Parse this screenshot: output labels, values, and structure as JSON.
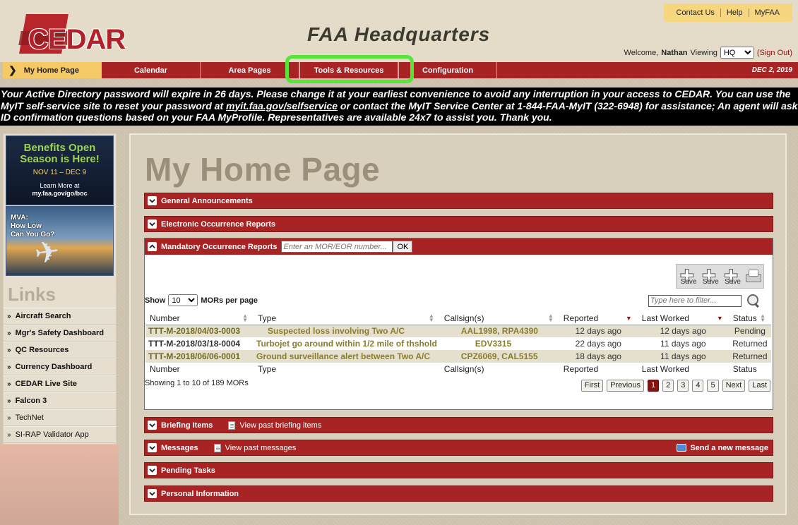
{
  "header": {
    "logo_text": "CEDAR",
    "title": "FAA Headquarters",
    "top_links": [
      "Contact Us",
      "Help",
      "MyFAA"
    ],
    "welcome_label": "Welcome,",
    "user_name": "Nathan",
    "viewing_label": "Viewing",
    "viewing_value": "HQ",
    "sign_out": "(Sign Out)"
  },
  "nav": {
    "home": "My Home Page",
    "items": [
      "Calendar",
      "Area Pages",
      "Tools & Resources",
      "Configuration"
    ],
    "date": "DEC 2, 2019"
  },
  "alert": {
    "text_before": "Your Active Directory password will expire in 26 days. Please change it at your earliest convenience to avoid any interruption in your access to CEDAR. You can use the MyIT self-service site to reset your password at ",
    "link": "myit.faa.gov/selfservice",
    "text_after": " or contact the MyIT Service Center at 1-844-FAA-MyIT (322-6948) for assistance; An agent will ask ID confirmation questions based on your FAA MyProfile. Representatives are available 24x7 to assist you. Thank you."
  },
  "sidebar": {
    "banner1": {
      "headline_1": "Benefits Open",
      "headline_2": "Season is Here!",
      "dates": "NOV 11 – DEC 9",
      "small": "Learn More at",
      "url": "my.faa.gov/go/boc"
    },
    "banner2": {
      "line1": "MVA:",
      "line2": "How Low",
      "line3": "Can You Go?"
    },
    "links_title": "Links",
    "links": [
      {
        "label": "Aircraft Search"
      },
      {
        "label": "Mgr's Safety Dashboard"
      },
      {
        "label": "QC Resources"
      },
      {
        "label": "Currency Dashboard"
      },
      {
        "label": "CEDAR Live Site"
      },
      {
        "label": "Falcon 3"
      },
      {
        "label": "TechNet"
      },
      {
        "label": "SI-RAP Validator App"
      }
    ]
  },
  "main": {
    "page_title": "My Home Page",
    "sections": {
      "general": "General Announcements",
      "eor": "Electronic Occurrence Reports",
      "mor": "Mandatory Occurrence Reports",
      "briefing": "Briefing Items",
      "briefing_link": "View past briefing items",
      "messages": "Messages",
      "messages_link": "View past messages",
      "send_message": "Send a new message",
      "pending": "Pending Tasks",
      "personal": "Personal Information"
    },
    "mor": {
      "search_placeholder": "Enter an MOR/EOR number...",
      "ok": "OK",
      "toolbar_save": "Save",
      "show_label": "Show",
      "show_value": "10",
      "per_page": "MORs per page",
      "filter_placeholder": "Type here to filter...",
      "columns": [
        "Number",
        "Type",
        "Callsign(s)",
        "Reported",
        "Last Worked",
        "Status"
      ],
      "rows": [
        {
          "number": "TTT-M-2018/04/03-0003",
          "type": "Suspected loss involving Two A/C",
          "callsigns": "AAL1998, RPA4390",
          "reported": "12 days ago",
          "last_worked": "12 days ago",
          "status": "Pending"
        },
        {
          "number": "TTT-M-2018/03/18-0004",
          "type": "Turbojet go around within 1/2 mile of thshold",
          "callsigns": "EDV3315",
          "reported": "22 days ago",
          "last_worked": "11 days ago",
          "status": "Returned"
        },
        {
          "number": "TTT-M-2018/06/06-0001",
          "type": "Ground surveillance alert between Two A/C",
          "callsigns": "CPZ6069, CAL5155",
          "reported": "18 days ago",
          "last_worked": "11 days ago",
          "status": "Returned"
        }
      ],
      "summary": "Showing 1 to 10 of 189 MORs",
      "pager": [
        "First",
        "Previous",
        "1",
        "2",
        "3",
        "4",
        "5",
        "Next",
        "Last"
      ],
      "current_page": "1"
    }
  },
  "colors": {
    "nav_red": "#a82424",
    "home_tab": "#f5c966",
    "highlight": "#56e63a"
  }
}
